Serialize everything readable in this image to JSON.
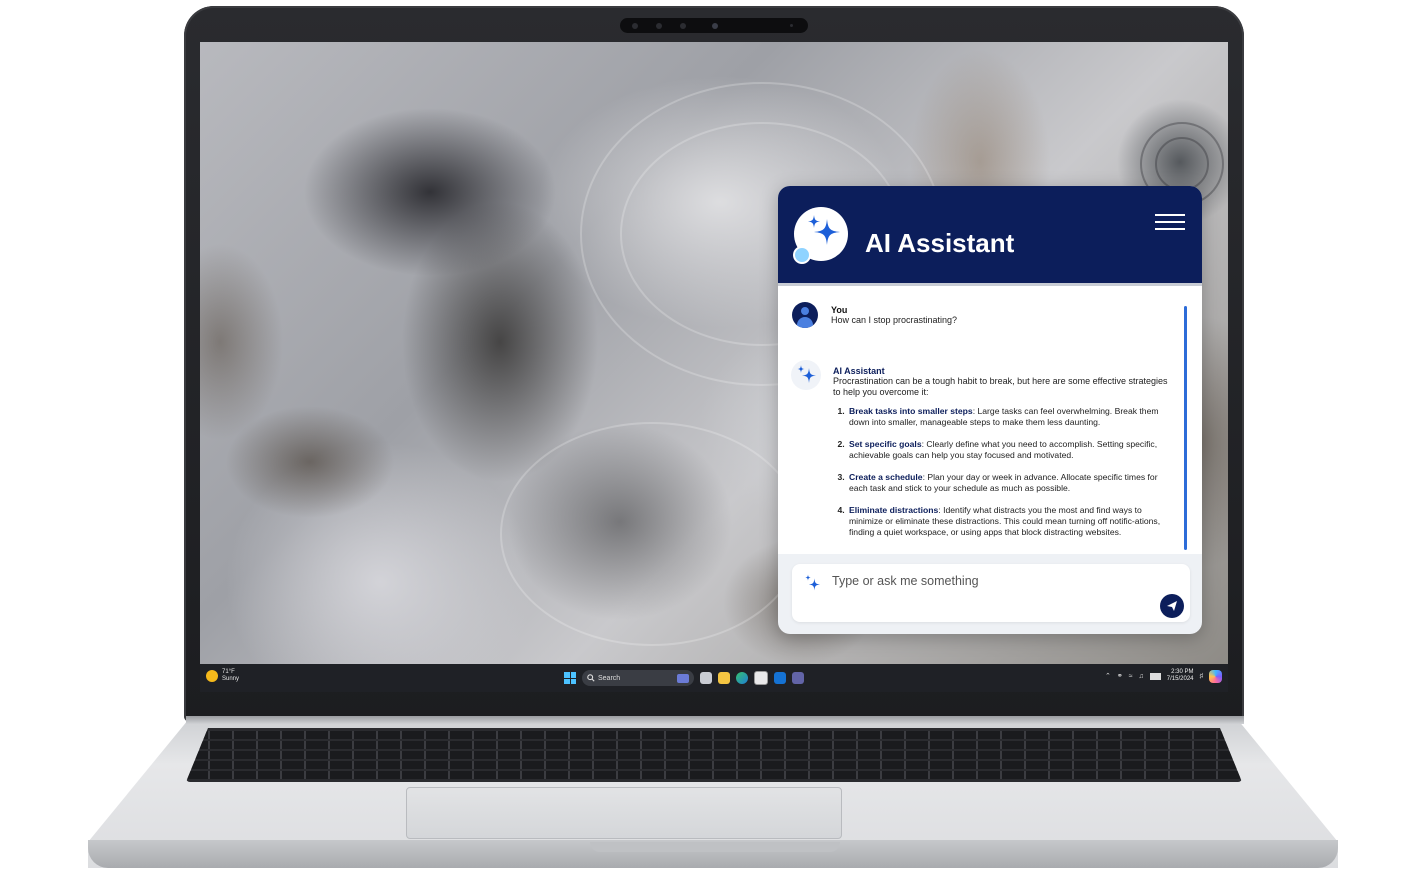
{
  "assistant": {
    "title": "AI Assistant",
    "user_message": {
      "sender": "You",
      "text": "How can I stop procrastinating?"
    },
    "ai_message": {
      "sender": "AI Assistant",
      "intro": "Procrastination can be a tough habit to break, but here are some effective strategies to help you overcome it:",
      "tips": [
        {
          "title": "Break tasks into smaller steps",
          "text": ": Large tasks can feel overwhelming. Break them down into smaller, manageable steps to make them less daunting."
        },
        {
          "title": "Set specific goals",
          "text": ": Clearly define what you need to accomplish. Setting specific, achievable goals can help you stay focused and motivated."
        },
        {
          "title": "Create a schedule",
          "text": ": Plan your day or week in advance. Allocate specific times for each task and stick to your schedule as much as possible."
        },
        {
          "title": "Eliminate distractions",
          "text": ": Identify what distracts you the most and find ways to minimize or eliminate these distractions. This could mean turning off notific-ations, finding a quiet workspace, or using apps that block distracting websites."
        }
      ]
    },
    "input": {
      "placeholder": "Type or ask me something",
      "value": ""
    },
    "colors": {
      "header": "#0c1e5b",
      "accent": "#2d6cd8"
    }
  },
  "taskbar": {
    "weather": {
      "temp": "71°F",
      "condition": "Sunny"
    },
    "search_placeholder": "Search",
    "clock": {
      "time": "2:30 PM",
      "date": "7/15/2024"
    },
    "apps": [
      "task-view-icon",
      "file-explorer-icon",
      "edge-icon",
      "store-icon",
      "outlook-icon",
      "teams-icon"
    ]
  }
}
